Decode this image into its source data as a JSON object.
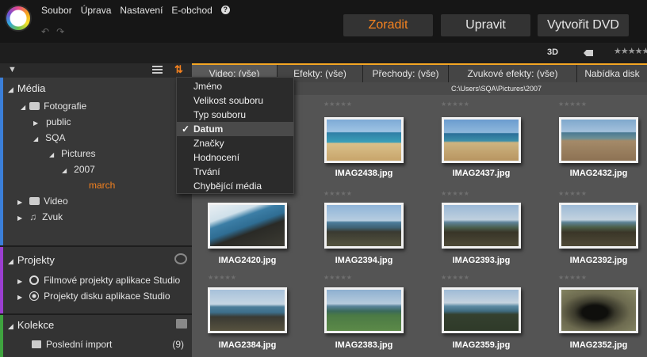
{
  "menu": {
    "items": [
      "Soubor",
      "Úprava",
      "Nastavení",
      "E-obchod"
    ],
    "help_glyph": "?"
  },
  "toolbar": {
    "undo_glyph": "↶",
    "redo_glyph": "↷",
    "organize_label": "Zoradit",
    "edit_label": "Upravit",
    "create_dvd_label": "Vytvořit DVD",
    "accent_color": "#f5821f"
  },
  "view_strip": {
    "label_3d": "3D",
    "rating_filter": "★★★★★"
  },
  "library_tabs": [
    "Video: (vše)",
    "Efekty: (vše)",
    "Přechody: (vše)",
    "Zvukové efekty: (vše)",
    "Nabídka disk"
  ],
  "path": "C:\\Users\\SQA\\Pictures\\2007",
  "tree": {
    "media": {
      "title": "Média",
      "photos": "Fotografie",
      "public": "public",
      "sqa": "SQA",
      "pictures": "Pictures",
      "year": "2007",
      "march": "march",
      "video": "Video",
      "audio": "Zvuk"
    },
    "projects": {
      "title": "Projekty",
      "movie_projects": "Filmové projekty aplikace Studio",
      "disc_projects": "Projekty disku aplikace Studio"
    },
    "collections": {
      "title": "Kolekce",
      "last_import": "Poslední import",
      "last_import_count": "(9)"
    }
  },
  "sort_menu": {
    "items": [
      "Jméno",
      "Velikost souboru",
      "Typ souboru",
      "Datum",
      "Značky",
      "Hodnocení",
      "Trvání",
      "Chybějící média"
    ],
    "selected": "Datum",
    "check_glyph": "✓"
  },
  "assets": [
    {
      "name": "IMAG2438.jpg",
      "rating": "★★★★★"
    },
    {
      "name": "IMAG2437.jpg",
      "rating": "★★★★★"
    },
    {
      "name": "IMAG2432.jpg",
      "rating": "★★★★★"
    },
    {
      "name": "IMAG2420.jpg",
      "rating": "★★★★★"
    },
    {
      "name": "IMAG2394.jpg",
      "rating": "★★★★★"
    },
    {
      "name": "IMAG2393.jpg",
      "rating": "★★★★★"
    },
    {
      "name": "IMAG2392.jpg",
      "rating": "★★★★★"
    },
    {
      "name": "IMAG2384.jpg",
      "rating": "★★★★★"
    },
    {
      "name": "IMAG2383.jpg",
      "rating": "★★★★★"
    },
    {
      "name": "IMAG2359.jpg",
      "rating": "★★★★★"
    },
    {
      "name": "IMAG2352.jpg",
      "rating": "★★★★★"
    }
  ]
}
